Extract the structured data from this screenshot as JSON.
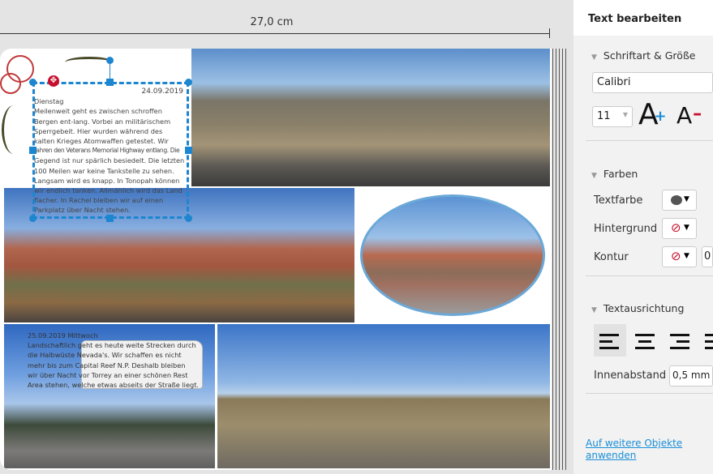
{
  "ruler": {
    "label": "27,0 cm"
  },
  "textbox1": {
    "date": "24.09.2019",
    "lines": [
      "Dienstag",
      "Meilenweit geht es zwischen schroffen",
      "Bergen ent-lang. Vorbei an militärischem",
      "Sperrgebeit. Hier wurden während des",
      "kalten Krieges Atomwaffen getestet.     Wir",
      "fahren den Veterans Memorial Highway entlang. Die",
      "Gegend ist nur spärlich besiedelt. Die letzten",
      "100 Meilen war keine Tankstelle zu sehen.",
      "Langsam wird es knapp. In Tonopah können",
      "wir endlich tanken. Allmählich wird das Land",
      "flacher.  In Rachel bleiben wir auf einen",
      "Parkplatz über Nacht stehen."
    ]
  },
  "textbox2": {
    "lines": [
      "25.09.2019 Mittwoch",
      "Landschaftlich geht es heute weite Strecken durch",
      "die Halbwüste Nevada's.  Wir schaffen es nicht",
      "mehr bis zum Capital Reef N.P. Deshalb bleiben",
      "wir über Nacht vor Torrey an einer schönen Rest",
      "Area stehen, welche etwas abseits der Straße liegt."
    ]
  },
  "panel": {
    "title": "Text bearbeiten",
    "font_section": "Schriftart & Größe",
    "font": "Calibri",
    "size": "11",
    "grow_label": "A",
    "shrink_label": "A",
    "colors_section": "Farben",
    "text_color_label": "Textfarbe",
    "background_label": "Hintergrund",
    "outline_label": "Kontur",
    "outline_value": "0",
    "align_section": "Textausrichtung",
    "padding_label": "Innenabstand",
    "padding_value": "0,5 mm",
    "apply_link": "Auf weitere Objekte anwenden",
    "selected_alignment": "left",
    "accent": "#1a8fd8"
  }
}
